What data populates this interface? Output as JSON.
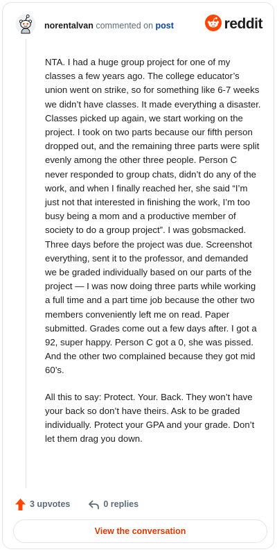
{
  "header": {
    "username": "norentalvan",
    "action_text": "commented on",
    "post_link": "post",
    "brand_name": "reddit",
    "avatar_icon": "snoo-avatar-icon",
    "brand_icon": "reddit-logo-icon"
  },
  "comment": {
    "paragraphs": [
      "NTA. I had a huge group project for one of my classes a few years ago. The college educator’s union went on strike, so for something like 6-7 weeks we didn’t have classes. It made everything a disaster. Classes picked up again, we start working on the project. I took on two parts because our fifth person dropped out, and the remaining three parts were split evenly among the other three people. Person C never responded to group chats, didn’t do any of the work, and when I finally reached her, she said “I’m just not that interested in finishing the work, I’m too busy being a mom and a productive member of society to do a group project”. I was gobsmacked. Three days before the project was due. Screenshot everything, sent it to the professor, and demanded we be graded individually based on our parts of the project — I was now doing three parts while working a full time and a part time job because the other two members conveniently left me on read. Paper submitted. Grades come out a few days after. I got a 92, super happy. Person C got a 0, she was pissed. And the other two complained because they got mid 60’s.",
      "All this to say: Protect. Your. Back. They won’t have your back so don’t have theirs. Ask to be graded individually. Protect your GPA and your grade. Don’t let them drag you down."
    ]
  },
  "actions": {
    "upvotes_label": "3 upvotes",
    "replies_label": "0 replies",
    "upvote_icon": "upvote-arrow-icon",
    "reply_icon": "reply-arrow-icon"
  },
  "footer": {
    "view_label": "View the conversation"
  },
  "colors": {
    "brand_orange": "#ff4500",
    "link_blue": "#0a449b",
    "muted_text": "#5c6c74",
    "button_text": "#d93a00",
    "border": "#e3e5e7"
  }
}
